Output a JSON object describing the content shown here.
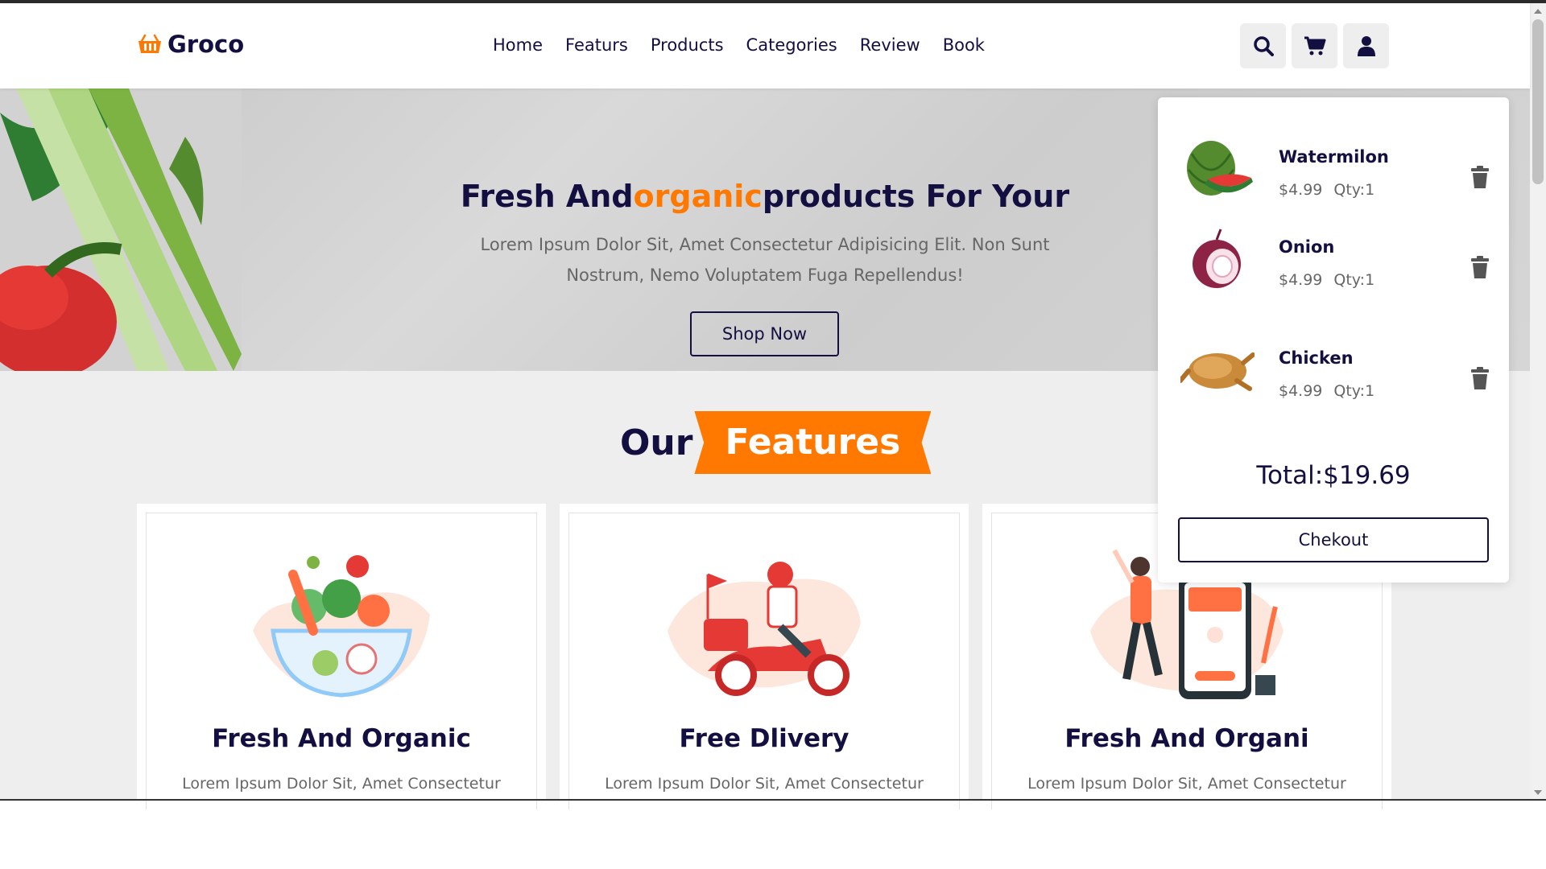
{
  "header": {
    "logo_text": "Groco",
    "nav": [
      "Home",
      "Featurs",
      "Products",
      "Categories",
      "Review",
      "Book"
    ],
    "icons": [
      "search-icon",
      "cart-icon",
      "user-icon"
    ]
  },
  "hero": {
    "title_part1": "Fresh And",
    "title_accent": "organic",
    "title_part2": "products For Your",
    "text": "Lorem Ipsum Dolor Sit, Amet Consectetur Adipisicing Elit. Non Sunt Nostrum, Nemo Voluptatem Fuga Repellendus!",
    "button": "Shop Now"
  },
  "features": {
    "heading_our": "Our",
    "heading_tag": "Features",
    "cards": [
      {
        "title": "Fresh And Organic",
        "text": "Lorem Ipsum Dolor Sit, Amet Consectetur"
      },
      {
        "title": "Free Dlivery",
        "text": "Lorem Ipsum Dolor Sit, Amet Consectetur"
      },
      {
        "title": "Fresh And Organi",
        "text": "Lorem Ipsum Dolor Sit, Amet Consectetur"
      }
    ]
  },
  "cart": {
    "items": [
      {
        "name": "Watermilon",
        "price": "$4.99",
        "qty": "Qty:1"
      },
      {
        "name": "Onion",
        "price": "$4.99",
        "qty": "Qty:1"
      },
      {
        "name": "Chicken",
        "price": "$4.99",
        "qty": "Qty:1"
      }
    ],
    "total": "Total:$19.69",
    "checkout": "Chekout"
  },
  "colors": {
    "accent": "#ff7800",
    "dark": "#130f40",
    "bg": "#eeeeee"
  }
}
